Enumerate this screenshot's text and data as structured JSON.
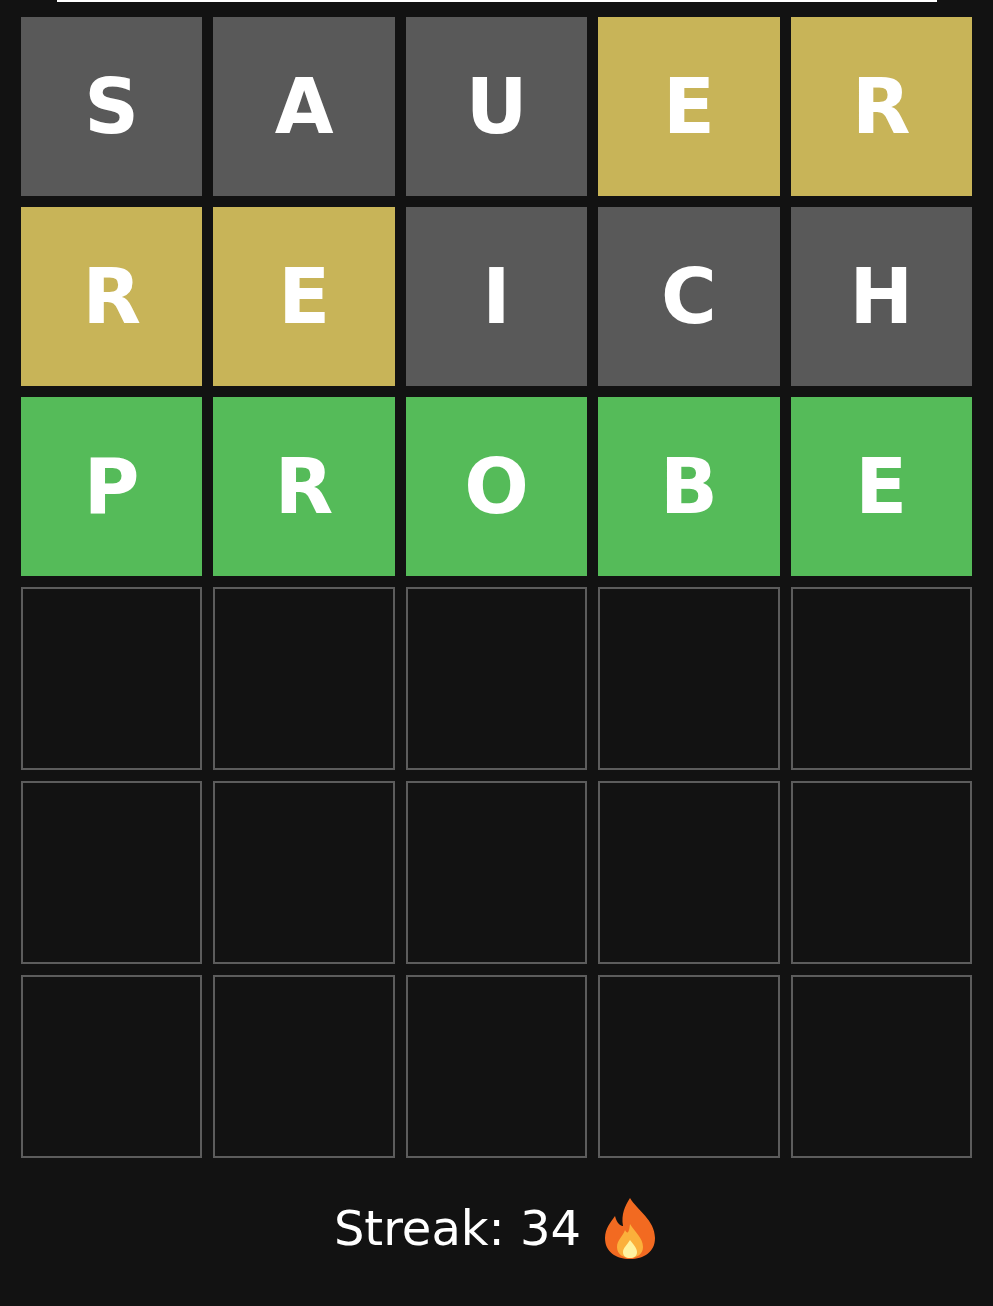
{
  "board": [
    [
      {
        "letter": "S",
        "kind": "absent"
      },
      {
        "letter": "A",
        "kind": "absent"
      },
      {
        "letter": "U",
        "kind": "absent"
      },
      {
        "letter": "E",
        "kind": "present"
      },
      {
        "letter": "R",
        "kind": "present"
      }
    ],
    [
      {
        "letter": "R",
        "kind": "present"
      },
      {
        "letter": "E",
        "kind": "present"
      },
      {
        "letter": "I",
        "kind": "absent"
      },
      {
        "letter": "C",
        "kind": "absent"
      },
      {
        "letter": "H",
        "kind": "absent"
      }
    ],
    [
      {
        "letter": "P",
        "kind": "correct"
      },
      {
        "letter": "R",
        "kind": "correct"
      },
      {
        "letter": "O",
        "kind": "correct"
      },
      {
        "letter": "B",
        "kind": "correct"
      },
      {
        "letter": "E",
        "kind": "correct"
      }
    ],
    [
      {
        "kind": "empty"
      },
      {
        "kind": "empty"
      },
      {
        "kind": "empty"
      },
      {
        "kind": "empty"
      },
      {
        "kind": "empty"
      }
    ],
    [
      {
        "kind": "empty"
      },
      {
        "kind": "empty"
      },
      {
        "kind": "empty"
      },
      {
        "kind": "empty"
      },
      {
        "kind": "empty"
      }
    ],
    [
      {
        "kind": "empty"
      },
      {
        "kind": "empty"
      },
      {
        "kind": "empty"
      },
      {
        "kind": "empty"
      },
      {
        "kind": "empty"
      }
    ]
  ],
  "streak": {
    "label": "Streak: 34"
  }
}
